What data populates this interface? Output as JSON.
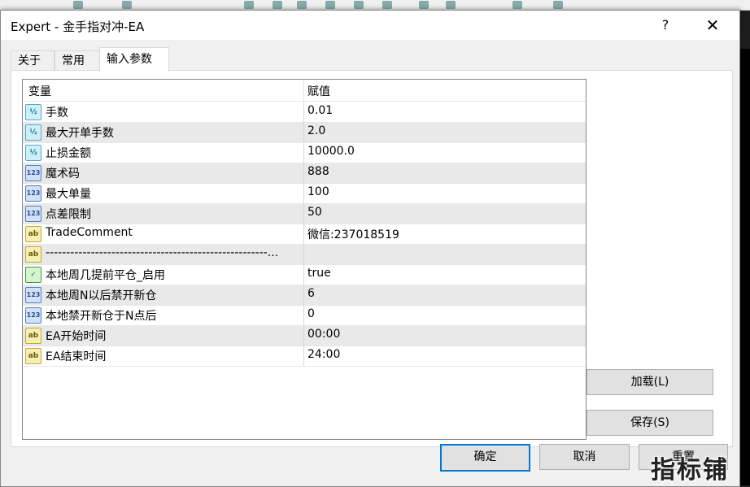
{
  "window": {
    "title": "Expert - 金手指对冲-EA",
    "help_glyph": "?",
    "close_glyph": "✕"
  },
  "tabs": [
    {
      "label": "关于"
    },
    {
      "label": "常用"
    },
    {
      "label": "输入参数"
    }
  ],
  "grid": {
    "headers": {
      "variable": "变量",
      "value": "赋值"
    },
    "rows": [
      {
        "icon": "double-type-icon",
        "icon_text": "½",
        "name": "手数",
        "value": "0.01"
      },
      {
        "icon": "double-type-icon",
        "icon_text": "½",
        "name": "最大开单手数",
        "value": "2.0"
      },
      {
        "icon": "double-type-icon",
        "icon_text": "½",
        "name": "止损金额",
        "value": "10000.0"
      },
      {
        "icon": "integer-type-icon",
        "icon_text": "123",
        "name": "魔术码",
        "value": "888"
      },
      {
        "icon": "integer-type-icon",
        "icon_text": "123",
        "name": "最大单量",
        "value": "100"
      },
      {
        "icon": "integer-type-icon",
        "icon_text": "123",
        "name": "点差限制",
        "value": "50"
      },
      {
        "icon": "string-type-icon",
        "icon_text": "ab",
        "name": "TradeComment",
        "value": "微信:237018519"
      },
      {
        "icon": "string-type-icon",
        "icon_text": "ab",
        "name": "------------------------------------------------------...",
        "value": ""
      },
      {
        "icon": "bool-type-icon",
        "icon_text": "✓",
        "name": "本地周几提前平仓_启用",
        "value": "true"
      },
      {
        "icon": "integer-type-icon",
        "icon_text": "123",
        "name": "本地周N以后禁开新仓",
        "value": "6"
      },
      {
        "icon": "integer-type-icon",
        "icon_text": "123",
        "name": "本地禁开新仓于N点后",
        "value": "0"
      },
      {
        "icon": "string-type-icon",
        "icon_text": "ab",
        "name": "EA开始时间",
        "value": "00:00"
      },
      {
        "icon": "string-type-icon",
        "icon_text": "ab",
        "name": "EA结束时间",
        "value": "24:00"
      }
    ]
  },
  "buttons": {
    "load": "加载(L)",
    "save": "保存(S)",
    "ok": "确定",
    "cancel": "取消",
    "reset": "重置"
  },
  "watermark": "指标铺"
}
